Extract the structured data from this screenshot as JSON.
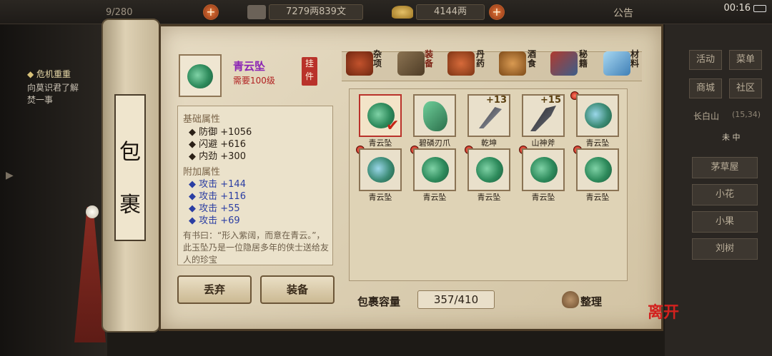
{
  "status_bar": {
    "capacity_partial": "9/280",
    "copper": "7279两839文",
    "silver": "4144两",
    "announcement": "公告",
    "clock": "00:16"
  },
  "left_panel": {
    "quest_title": "危机重重",
    "quest_line1": "向莫识君了解",
    "quest_line2": "焚一事"
  },
  "right_panel": {
    "btn_activity": "活动",
    "btn_menu": "菜单",
    "btn_mall": "商城",
    "btn_community": "社区",
    "location": "长白山",
    "coords": "(15,34)",
    "time": "未 中",
    "npcs": [
      "茅草屋",
      "小花",
      "小果",
      "刘树"
    ]
  },
  "scroll": {
    "title_char1": "包",
    "title_char2": "裹"
  },
  "item": {
    "name": "青云坠",
    "level_req": "需要100级",
    "tag": "挂件",
    "base_header": "基础属性",
    "base_stats": [
      "防御  +1056",
      "闪避  +616",
      "内劲  +300"
    ],
    "extra_header": "附加属性",
    "extra_stats": [
      "攻击  +144",
      "攻击  +116",
      "攻击  +55",
      "攻击  +69"
    ],
    "description": "有书曰：“形入紫阔，而意在青云。”，此玉坠乃是一位隐居多年的侠士送给友人的珍宝"
  },
  "tabs": [
    {
      "label": "杂项",
      "icon": "jar-icon"
    },
    {
      "label": "装备",
      "icon": "scroll-bundle-icon"
    },
    {
      "label": "丹药",
      "icon": "pills-icon"
    },
    {
      "label": "酒食",
      "icon": "food-icon"
    },
    {
      "label": "秘籍",
      "icon": "books-icon"
    },
    {
      "label": "材料",
      "icon": "crystal-icon"
    }
  ],
  "inventory": [
    {
      "name": "青云坠",
      "kind": "jade",
      "selected": true
    },
    {
      "name": "碧磷刃爪",
      "kind": "claw"
    },
    {
      "name": "乾坤",
      "kind": "blade",
      "plus": "+13"
    },
    {
      "name": "山神斧",
      "kind": "axe",
      "plus": "+15"
    },
    {
      "name": "青云坠",
      "kind": "jade-blue"
    },
    {
      "name": "青云坠",
      "kind": "jade-blue"
    },
    {
      "name": "青云坠",
      "kind": "jade"
    },
    {
      "name": "青云坠",
      "kind": "jade"
    },
    {
      "name": "青云坠",
      "kind": "jade"
    },
    {
      "name": "青云坠",
      "kind": "jade"
    }
  ],
  "actions": {
    "discard": "丢弃",
    "equip": "装备",
    "capacity_label": "包裹容量",
    "capacity_value": "357/410",
    "sort": "整理",
    "leave": "离开"
  },
  "colors": {
    "item_name": "#8b24b4",
    "level_req": "#b02020",
    "accent_red": "#b9322a"
  }
}
